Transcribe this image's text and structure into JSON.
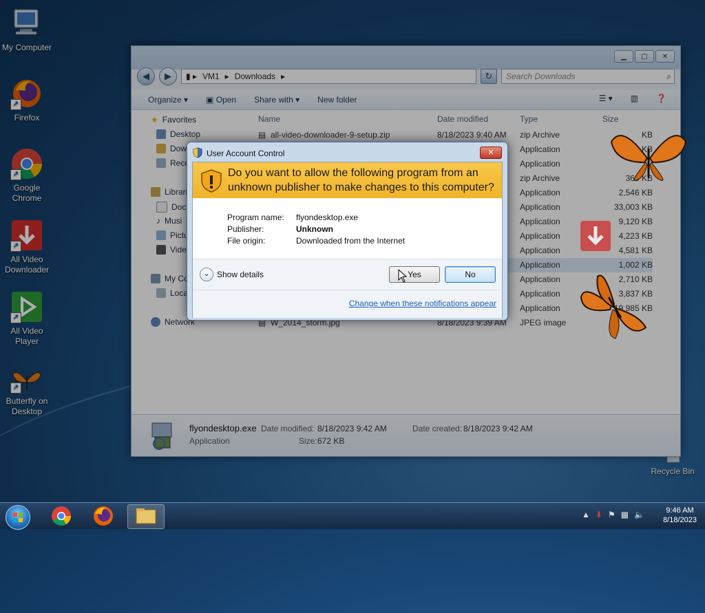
{
  "desktop": {
    "icons": [
      {
        "label": "My Computer"
      },
      {
        "label": "Firefox"
      },
      {
        "label": "Google Chrome"
      },
      {
        "label": "All Video Downloader"
      },
      {
        "label": "All Video Player"
      },
      {
        "label": "Butterfly on Desktop"
      },
      {
        "label": "Recycle Bin"
      }
    ]
  },
  "explorer": {
    "breadcrumb": [
      "VM1",
      "Downloads"
    ],
    "search_placeholder": "Search Downloads",
    "toolbar": {
      "organize": "Organize",
      "open": "Open",
      "share_with": "Share with",
      "new_folder": "New folder"
    },
    "columns": {
      "name": "Name",
      "date": "Date modified",
      "type": "Type",
      "size": "Size"
    },
    "nav": {
      "favorites": "Favorites",
      "desktop": "Desktop",
      "downloads": "Dow",
      "recent": "Rece",
      "libraries": "Librari",
      "documents": "Docu",
      "music": "Musi",
      "pictures": "Pictu",
      "videos": "Vide",
      "computer": "My Co",
      "local": "Loca",
      "network": "Network"
    },
    "files": [
      {
        "name": "all-video-downloader-9-setup.zip",
        "date": "8/18/2023 9:40 AM",
        "type": "zip Archive",
        "size": "KB"
      },
      {
        "name": "",
        "date": "",
        "type": "Application",
        "size": "KB"
      },
      {
        "name": "",
        "date": "",
        "type": "Application",
        "size": ""
      },
      {
        "name": "",
        "date": "",
        "type": "zip Archive",
        "size": "363 KB"
      },
      {
        "name": "",
        "date": "",
        "type": "Application",
        "size": "2,546 KB"
      },
      {
        "name": "",
        "date": "",
        "type": "Application",
        "size": "33,003 KB"
      },
      {
        "name": "",
        "date": "",
        "type": "Application",
        "size": "9,120 KB"
      },
      {
        "name": "",
        "date": "",
        "type": "Application",
        "size": "4,223 KB"
      },
      {
        "name": "",
        "date": "",
        "type": "Application",
        "size": "4,581 KB"
      },
      {
        "name": "",
        "date": "",
        "type": "Application",
        "size": "1,002 KB"
      },
      {
        "name": "",
        "date": "",
        "type": "Application",
        "size": "2,710 KB"
      },
      {
        "name": "",
        "date": "",
        "type": "Application",
        "size": "3,837 KB"
      },
      {
        "name": "",
        "date": "",
        "type": "Application",
        "size": "19,985 KB"
      },
      {
        "name": "W_2014_storm.jpg",
        "date": "8/18/2023 9:39 AM",
        "type": "JPEG image",
        "size": ""
      }
    ],
    "details": {
      "filename": "flyondesktop.exe",
      "type": "Application",
      "date_modified_label": "Date modified:",
      "date_modified": "8/18/2023 9:42 AM",
      "size_label": "Size:",
      "size": "672 KB",
      "date_created_label": "Date created:",
      "date_created": "8/18/2023 9:42 AM"
    }
  },
  "uac": {
    "title": "User Account Control",
    "question": "Do you want to allow the following program from an unknown publisher to make changes to this computer?",
    "program_name_label": "Program name:",
    "program_name": "flyondesktop.exe",
    "publisher_label": "Publisher:",
    "publisher": "Unknown",
    "file_origin_label": "File origin:",
    "file_origin": "Downloaded from the Internet",
    "show_details": "Show details",
    "yes": "Yes",
    "no": "No",
    "change_link": "Change when these notifications appear",
    "close_symbol": "✕"
  },
  "taskbar": {
    "time": "9:46 AM",
    "date": "8/18/2023"
  },
  "colors": {
    "banner": "#f0b429",
    "link": "#1e5fb8",
    "accent": "#3c7fb1"
  }
}
